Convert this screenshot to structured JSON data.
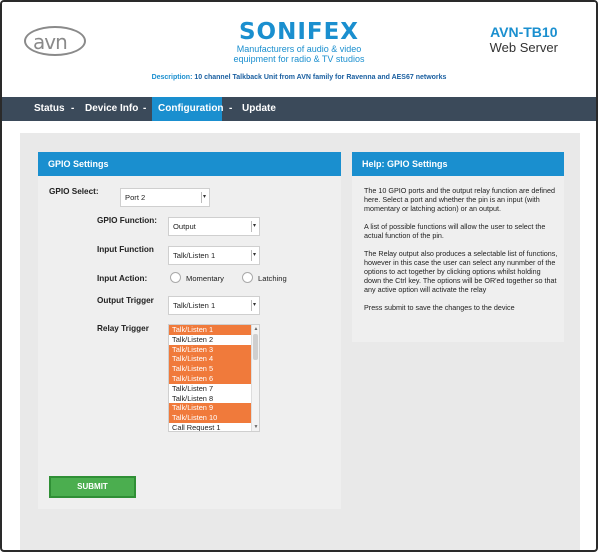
{
  "header": {
    "avn_logo_text": "avn",
    "brand_name": "SONIFEX",
    "brand_tagline_1": "Manufacturers of audio & video",
    "brand_tagline_2": "equipment for radio & TV studios",
    "model": "AVN-TB10",
    "subtitle": "Web Server",
    "description_label": "Description:",
    "description_text": "10 channel Talkback Unit from AVN family for Ravenna and AES67 networks"
  },
  "nav": {
    "items": [
      "Status",
      "Device Info",
      "Configuration",
      "Update"
    ],
    "separator": "-",
    "active": "Configuration"
  },
  "gpio": {
    "title": "GPIO Settings",
    "select_label": "GPIO Select:",
    "select_value": "Port 2",
    "function_label": "GPIO Function:",
    "function_value": "Output",
    "input_function_label": "Input Function",
    "input_function_value": "Talk/Listen 1",
    "input_action_label": "Input Action:",
    "input_action_options": [
      "Momentary",
      "Latching"
    ],
    "output_trigger_label": "Output Trigger",
    "output_trigger_value": "Talk/Listen 1",
    "relay_trigger_label": "Relay Trigger",
    "relay_options": [
      {
        "label": "Talk/Listen 1",
        "selected": true
      },
      {
        "label": "Talk/Listen 2",
        "selected": false
      },
      {
        "label": "Talk/Listen 3",
        "selected": true
      },
      {
        "label": "Talk/Listen 4",
        "selected": true
      },
      {
        "label": "Talk/Listen 5",
        "selected": true
      },
      {
        "label": "Talk/Listen 6",
        "selected": true
      },
      {
        "label": "Talk/Listen 7",
        "selected": false
      },
      {
        "label": "Talk/Listen 8",
        "selected": false
      },
      {
        "label": "Talk/Listen 9",
        "selected": true
      },
      {
        "label": "Talk/Listen 10",
        "selected": true
      },
      {
        "label": "Call Request 1",
        "selected": false
      }
    ],
    "submit_label": "SUBMIT"
  },
  "help": {
    "title": "Help: GPIO Settings",
    "paragraphs": [
      "The 10 GPIO ports and the output relay function are defined here. Select a port and whether the pin is an input (with momentary or latching action) or an output.",
      "A list of possible functions will allow the user to select the actual function of the pin.",
      "The Relay output also produces a selectable list of functions, however in this case the user can select any nunmber of the options to act together by clicking options whilst holding down the Ctrl key. The options will be OR'ed together so that any active option will activate the relay",
      "Press submit to save the changes to the device"
    ]
  },
  "colors": {
    "accent_blue": "#1a8fcf",
    "nav_bg": "#3b4a5a",
    "selected_orange": "#f07a3b",
    "submit_green": "#4bae4f"
  }
}
